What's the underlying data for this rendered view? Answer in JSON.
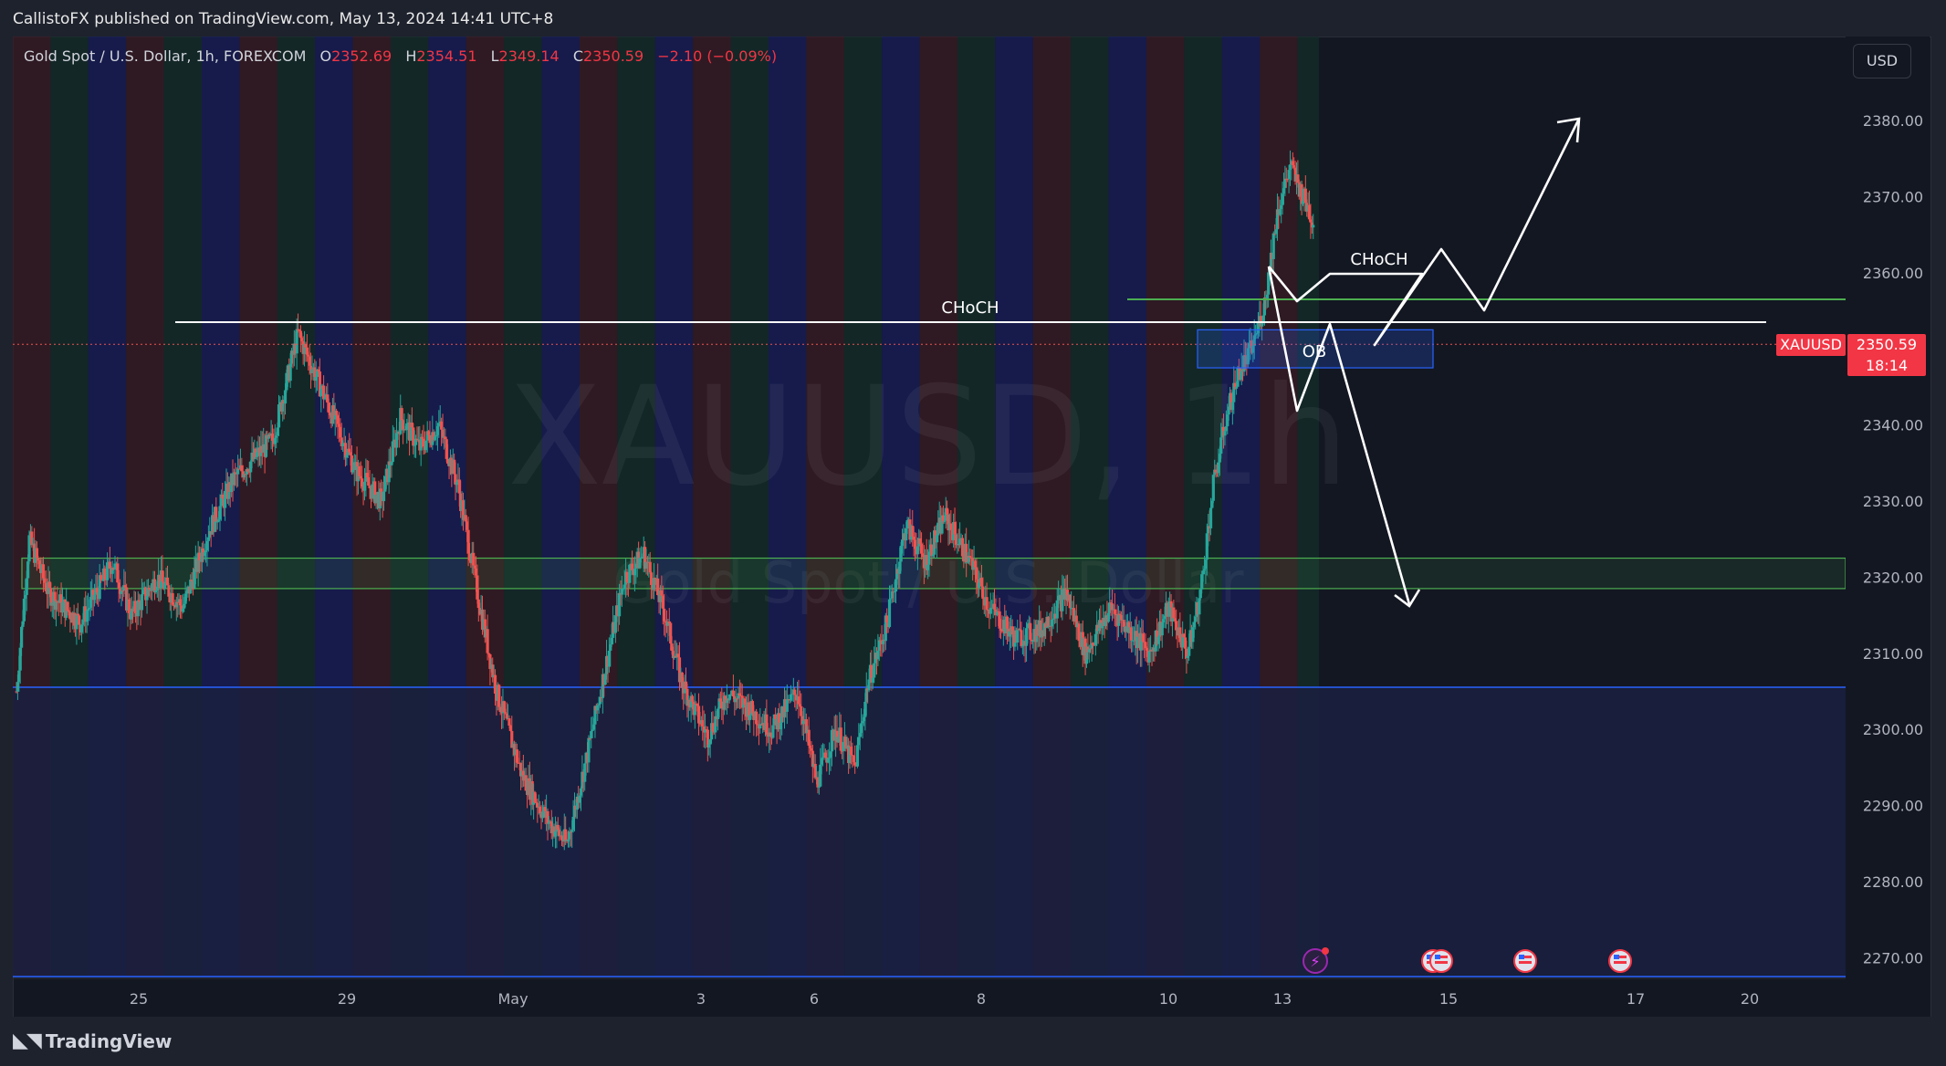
{
  "header": {
    "publisher": "CallistoFX published on TradingView.com, May 13, 2024 14:41 UTC+8"
  },
  "legend": {
    "symbol_desc": "Gold Spot / U.S. Dollar, 1h, FOREXCOM",
    "open_label": "O",
    "open": "2352.69",
    "high_label": "H",
    "high": "2354.51",
    "low_label": "L",
    "low": "2349.14",
    "close_label": "C",
    "close": "2350.59",
    "change": "−2.10 (−0.09%)"
  },
  "currency_button": "USD",
  "price_tag": {
    "symbol": "XAUUSD",
    "price": "2350.59",
    "countdown": "18:14"
  },
  "footer": {
    "brand": "TradingView"
  },
  "colors": {
    "up": "#26a69a",
    "down": "#ef5350",
    "accent": "#f23645",
    "session_red": "#3a1c24",
    "session_green": "#142e2a",
    "session_blue": "#181d5a"
  },
  "chart_data": {
    "type": "candlestick",
    "symbol": "XAUUSD",
    "watermark": {
      "ticker": "XAUUSD, 1h",
      "name": "Gold Spot / U.S. Dollar"
    },
    "ylim": [
      2265,
      2387
    ],
    "y_ticks": [
      2380,
      2370,
      2360,
      2350,
      2340,
      2330,
      2320,
      2310,
      2300,
      2290,
      2280,
      2270
    ],
    "x_ticks": [
      "25",
      "29",
      "May",
      "3",
      "6",
      "8",
      "10",
      "13",
      "15",
      "17",
      "20"
    ],
    "price_path": [
      [
        0,
        2305
      ],
      [
        10,
        2325
      ],
      [
        25,
        2318
      ],
      [
        50,
        2314
      ],
      [
        75,
        2322
      ],
      [
        90,
        2315
      ],
      [
        110,
        2320
      ],
      [
        130,
        2316
      ],
      [
        150,
        2326
      ],
      [
        170,
        2333
      ],
      [
        200,
        2338
      ],
      [
        220,
        2352
      ],
      [
        235,
        2346
      ],
      [
        250,
        2340
      ],
      [
        265,
        2334
      ],
      [
        285,
        2330
      ],
      [
        300,
        2341
      ],
      [
        315,
        2337
      ],
      [
        330,
        2340
      ],
      [
        345,
        2332
      ],
      [
        360,
        2318
      ],
      [
        375,
        2305
      ],
      [
        395,
        2294
      ],
      [
        415,
        2288
      ],
      [
        430,
        2285
      ],
      [
        445,
        2296
      ],
      [
        460,
        2308
      ],
      [
        475,
        2320
      ],
      [
        490,
        2323
      ],
      [
        505,
        2316
      ],
      [
        520,
        2306
      ],
      [
        540,
        2299
      ],
      [
        555,
        2305
      ],
      [
        570,
        2303
      ],
      [
        590,
        2300
      ],
      [
        610,
        2305
      ],
      [
        625,
        2293
      ],
      [
        640,
        2300
      ],
      [
        655,
        2295
      ],
      [
        665,
        2306
      ],
      [
        680,
        2314
      ],
      [
        695,
        2327
      ],
      [
        710,
        2322
      ],
      [
        725,
        2328
      ],
      [
        745,
        2322
      ],
      [
        760,
        2316
      ],
      [
        780,
        2312
      ],
      [
        800,
        2313
      ],
      [
        820,
        2318
      ],
      [
        835,
        2310
      ],
      [
        855,
        2316
      ],
      [
        870,
        2313
      ],
      [
        885,
        2310
      ],
      [
        900,
        2316
      ],
      [
        915,
        2310
      ],
      [
        925,
        2318
      ],
      [
        935,
        2332
      ],
      [
        945,
        2341
      ],
      [
        955,
        2347
      ],
      [
        965,
        2350
      ],
      [
        975,
        2356
      ],
      [
        985,
        2368
      ],
      [
        995,
        2374
      ],
      [
        1005,
        2370
      ],
      [
        1015,
        2366
      ],
      [
        1025,
        2362
      ],
      [
        1035,
        2364
      ],
      [
        1045,
        2358
      ],
      [
        1055,
        2351
      ],
      [
        1060,
        2350.59
      ]
    ],
    "annotations": [
      {
        "type": "hline",
        "label": "CHoCH",
        "price": 2353.5
      },
      {
        "type": "hline",
        "price": 2356.5
      },
      {
        "type": "zone",
        "price_top": 2322.5,
        "price_bottom": 2318.5
      },
      {
        "type": "zone",
        "label": "OB",
        "price_top": 2352.5,
        "price_bottom": 2347.5
      },
      {
        "type": "label",
        "label": "CHoCH",
        "price": 2361
      }
    ]
  }
}
